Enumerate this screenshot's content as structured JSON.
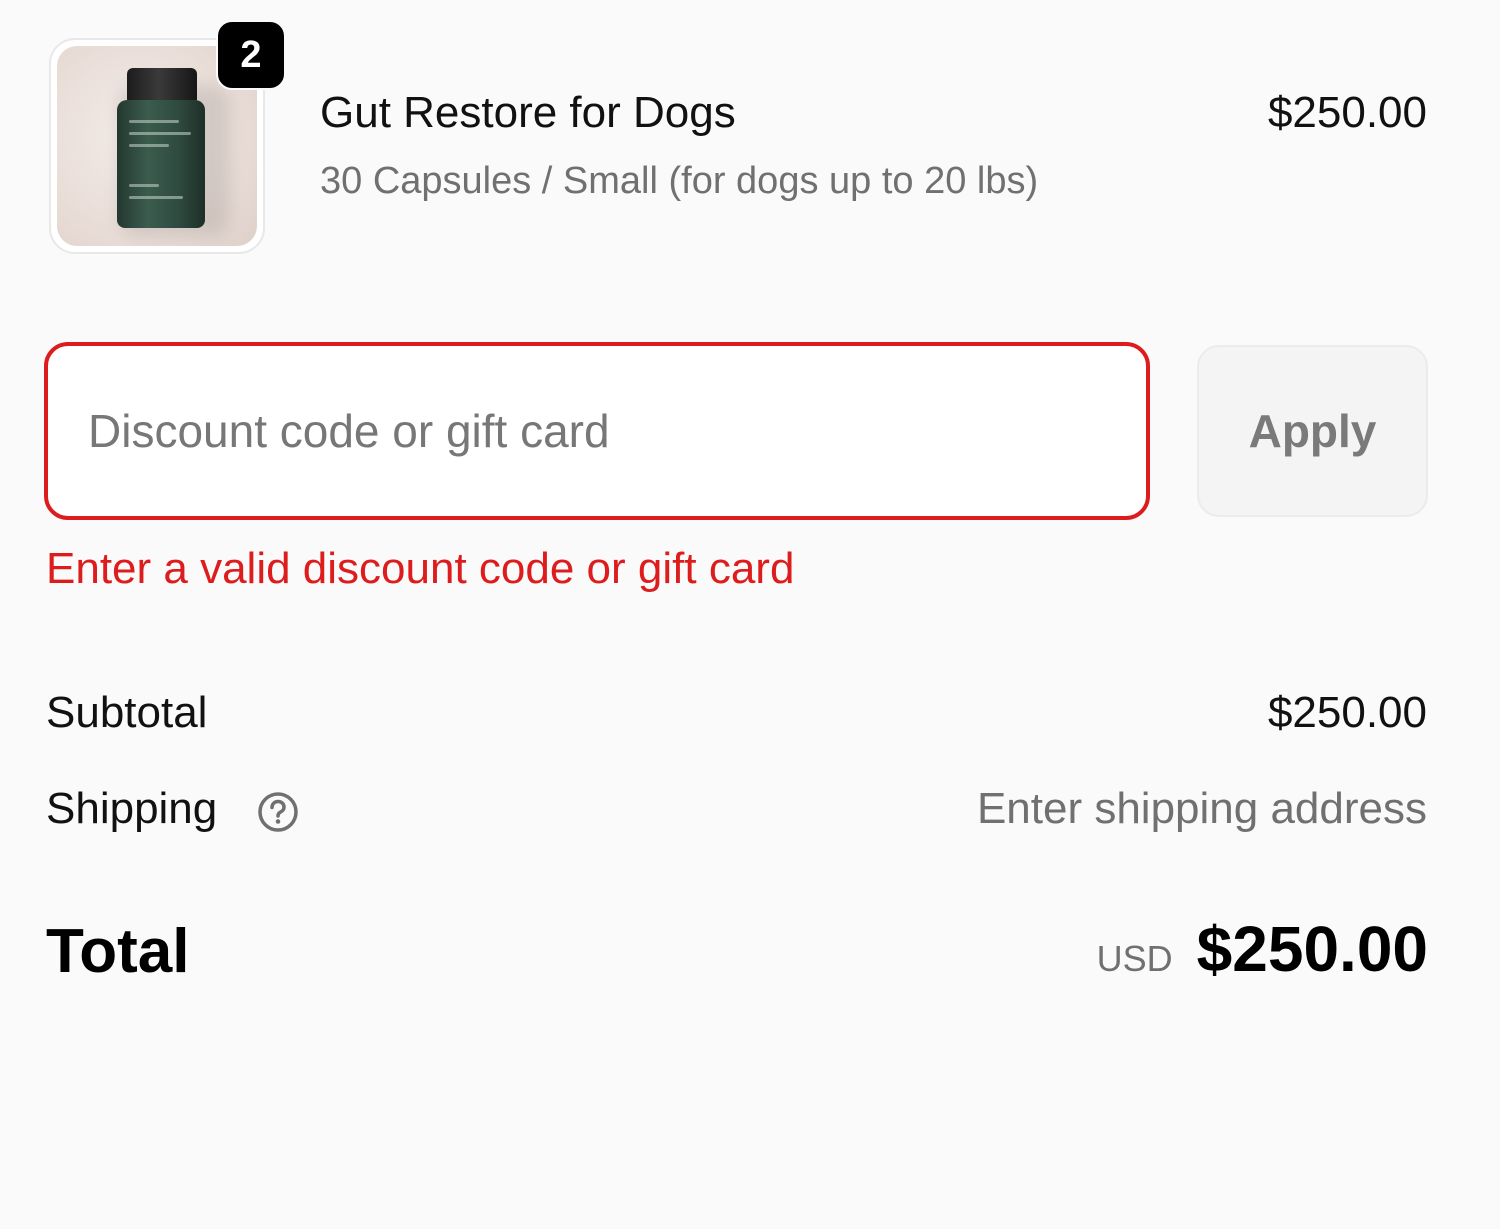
{
  "line_item": {
    "quantity": "2",
    "name": "Gut Restore for Dogs",
    "variant": "30 Capsules / Small (for dogs up to 20 lbs)",
    "price": "$250.00"
  },
  "discount": {
    "placeholder": "Discount code or gift card",
    "value": "",
    "apply_label": "Apply",
    "error": "Enter a valid discount code or gift card",
    "error_color": "#dd1d1d"
  },
  "summary": {
    "subtotal_label": "Subtotal",
    "subtotal_value": "$250.00",
    "shipping_label": "Shipping",
    "shipping_value": "Enter shipping address",
    "shipping_help_icon": "question-circle-icon",
    "total_label": "Total",
    "currency": "USD",
    "total_value": "$250.00"
  }
}
